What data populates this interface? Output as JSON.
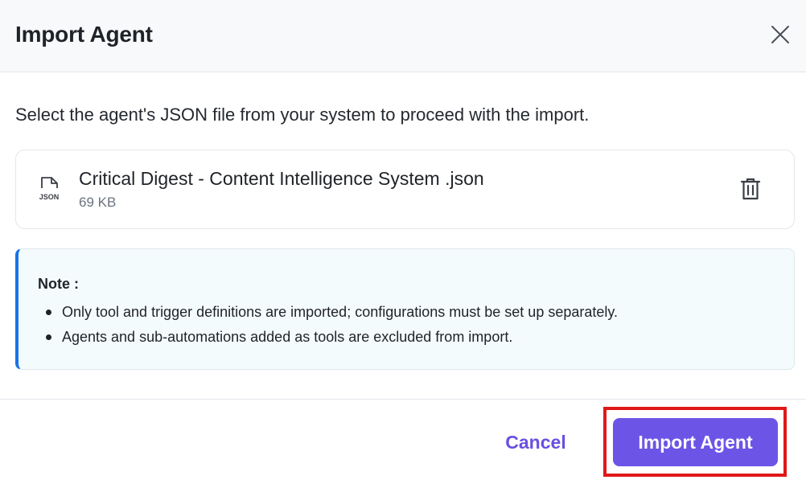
{
  "dialog": {
    "title": "Import Agent",
    "description": "Select the agent's JSON file from your system to proceed with the import."
  },
  "file": {
    "icon_label": "JSON",
    "name": "Critical Digest - Content Intelligence System .json",
    "size": "69 KB"
  },
  "note": {
    "title": "Note :",
    "items": [
      "Only tool and trigger definitions are imported; configurations must be set up separately.",
      "Agents and sub-automations added as tools are excluded from import."
    ]
  },
  "footer": {
    "cancel_label": "Cancel",
    "import_label": "Import Agent"
  },
  "icons": {
    "close": "close-icon",
    "file": "json-file-icon",
    "delete": "trash-icon"
  },
  "colors": {
    "accent": "#6c55e6",
    "cancel_text": "#6a4fe0",
    "note_border": "#1a73e8",
    "note_background": "#f4fbfd",
    "highlight": "#e01818"
  }
}
